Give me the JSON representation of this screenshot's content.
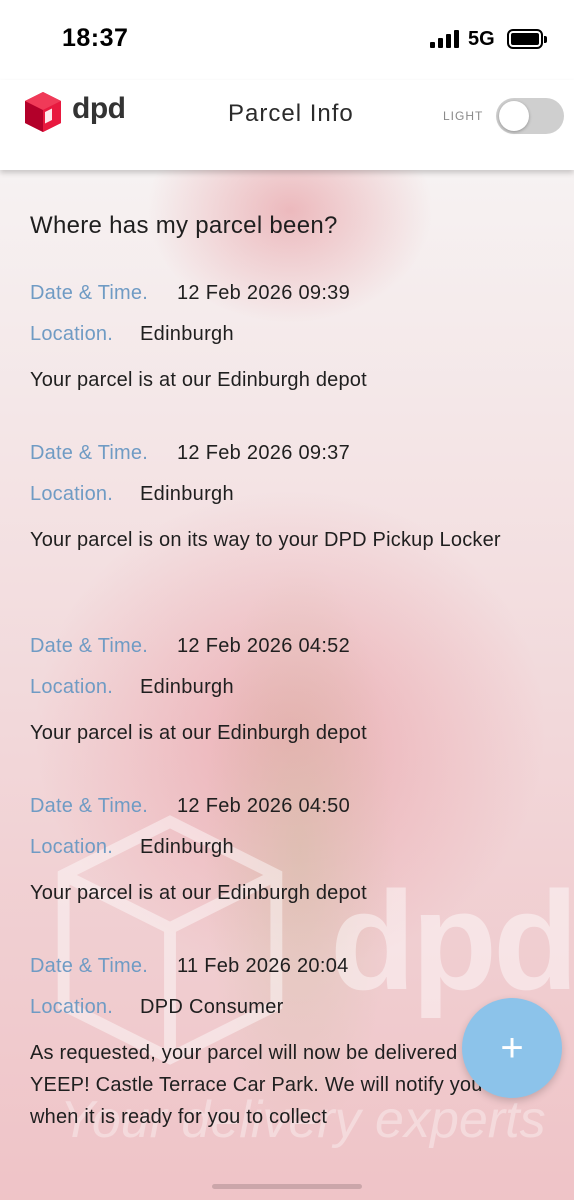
{
  "status_bar": {
    "time": "18:37",
    "network": "5G",
    "icons": [
      "signal-icon",
      "battery-icon"
    ]
  },
  "header": {
    "logo_text": "dpd",
    "title": "Parcel Info",
    "theme_toggle_label": "LIGHT",
    "theme_toggle_on": false
  },
  "history": {
    "heading": "Where has my parcel been?",
    "date_label": "Date & Time.",
    "location_label": "Location.",
    "events": [
      {
        "datetime": "12 Feb 2026 09:39",
        "location": "Edinburgh",
        "description": "Your parcel is at our Edinburgh depot"
      },
      {
        "datetime": "12 Feb 2026 09:37",
        "location": "Edinburgh",
        "description": "Your parcel is on its way to your DPD Pickup Locker"
      },
      {
        "datetime": "12 Feb 2026 04:52",
        "location": "Edinburgh",
        "description": "Your parcel is at our Edinburgh depot"
      },
      {
        "datetime": "12 Feb 2026 04:50",
        "location": "Edinburgh",
        "description": "Your parcel is at our Edinburgh depot"
      },
      {
        "datetime": "11 Feb 2026 20:04",
        "location": "DPD Consumer",
        "description": "As requested, your parcel will now be delivered to YEEP! Castle Terrace Car Park. We will notify you when it is ready for you to collect"
      }
    ]
  },
  "fab": {
    "icon": "plus-icon",
    "symbol": "+"
  },
  "background": {
    "watermark_text": "dpd",
    "slogan_text": "Your delivery experts"
  },
  "colors": {
    "brand_red": "#dc0032",
    "label_blue": "#6f9bc4",
    "fab_blue": "#8cc3ea"
  }
}
